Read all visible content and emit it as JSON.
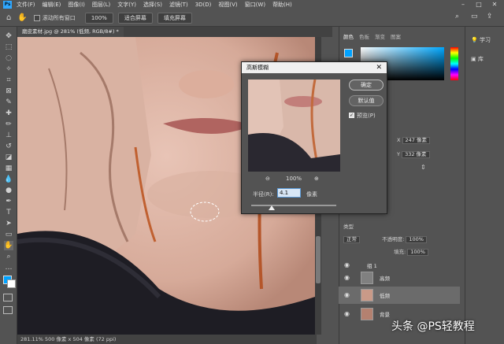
{
  "menu": {
    "logo": "Ps",
    "items": [
      "文件(F)",
      "编辑(E)",
      "图像(I)",
      "图层(L)",
      "文字(Y)",
      "选择(S)",
      "滤镜(T)",
      "3D(D)",
      "视图(V)",
      "窗口(W)",
      "帮助(H)"
    ]
  },
  "options": {
    "scroll_all_label": "滚动所有窗口",
    "zoom_value": "100%",
    "fit_screen": "适合屏幕",
    "fill_screen": "填充屏幕"
  },
  "document": {
    "tab_title": "磨皮素材.jpg @ 281% (低频, RGB/8#) *",
    "status": "281.11%    500 像素 x 504 像素 (72 ppi)"
  },
  "panels": {
    "color_tabs": [
      "颜色",
      "色板",
      "渐变",
      "图案"
    ],
    "right_strip": [
      "学习",
      "库"
    ],
    "props": {
      "x_label": "X",
      "x_value": "247 像素",
      "y_label": "Y",
      "y_value": "332 像素"
    },
    "layers_blend": "正常",
    "layers_opacity_label": "不透明度:",
    "layers_opacity": "100%",
    "layers_fill_label": "填充:",
    "layers_fill": "100%",
    "layers_filter": "类型",
    "layers": [
      {
        "name": "组 1",
        "selected": false
      },
      {
        "name": "高频",
        "selected": false
      },
      {
        "name": "低频",
        "selected": true
      },
      {
        "name": "背景",
        "selected": false
      }
    ]
  },
  "dialog": {
    "title": "高斯模糊",
    "ok": "确定",
    "reset": "默认值",
    "preview_label": "预览(P)",
    "zoom": "100%",
    "radius_label": "半径(R):",
    "radius_value": "4.1",
    "radius_unit": "像素"
  },
  "watermark": "头条 @PS轻教程",
  "colors": {
    "foreground": "#00a2ff",
    "ui_bg": "#535353"
  }
}
